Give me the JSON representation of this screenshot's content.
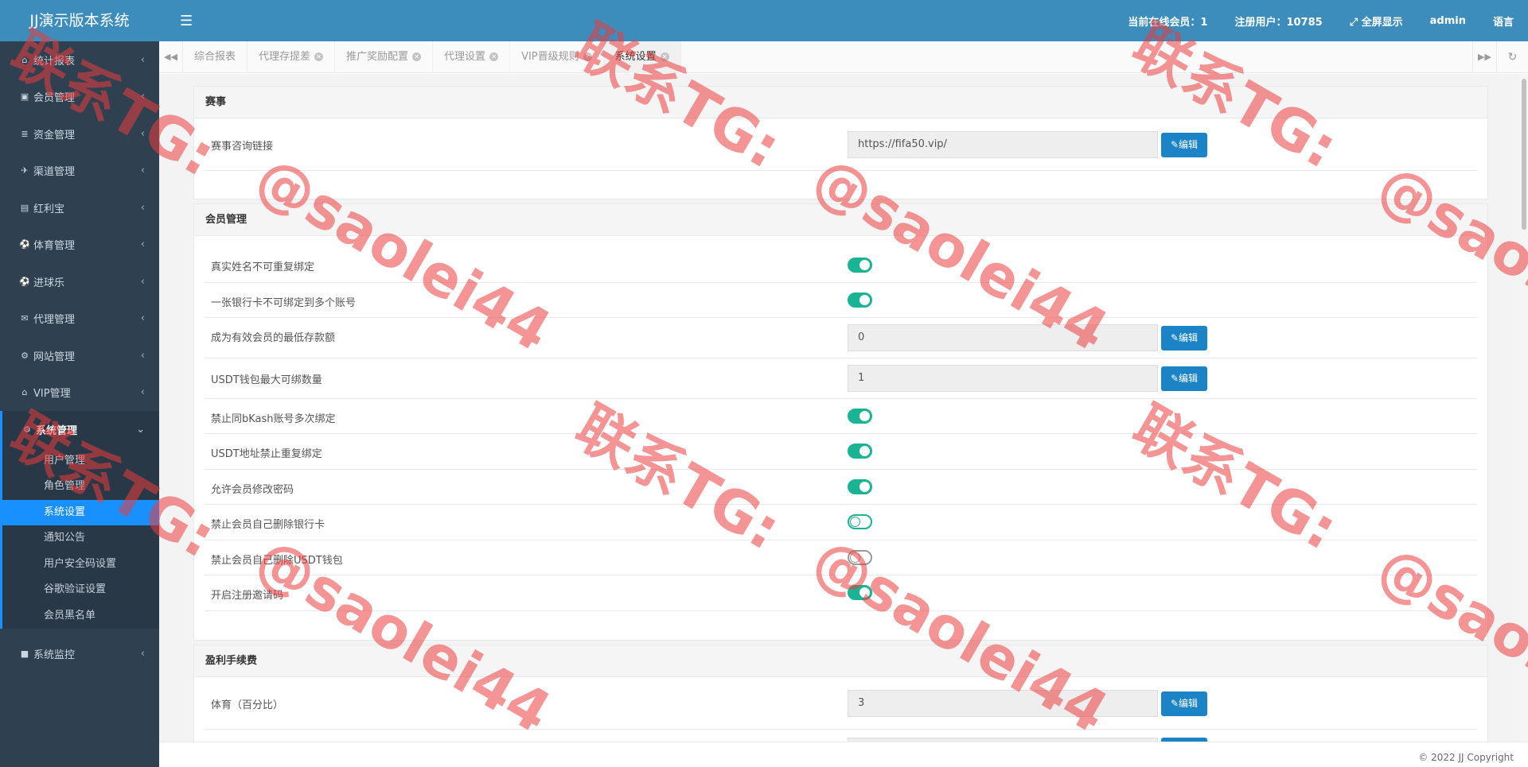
{
  "brand": "JJ演示版本系统",
  "sidebar": {
    "items": [
      {
        "label": "统计报表",
        "icon": "home-icon",
        "glyph": "⌂"
      },
      {
        "label": "会员管理",
        "icon": "user-icon",
        "glyph": "▣"
      },
      {
        "label": "资金管理",
        "icon": "database-icon",
        "glyph": "≣"
      },
      {
        "label": "渠道管理",
        "icon": "rocket-icon",
        "glyph": "✈"
      },
      {
        "label": "红利宝",
        "icon": "server-icon",
        "glyph": "▤"
      },
      {
        "label": "体育管理",
        "icon": "soccer-icon",
        "glyph": "⚽"
      },
      {
        "label": "进球乐",
        "icon": "soccer-icon",
        "glyph": "⚽"
      },
      {
        "label": "代理管理",
        "icon": "envelope-icon",
        "glyph": "✉"
      },
      {
        "label": "网站管理",
        "icon": "cogs-icon",
        "glyph": "⚙"
      },
      {
        "label": "VIP管理",
        "icon": "lock-icon",
        "glyph": "🔒"
      },
      {
        "label": "系统管理",
        "icon": "gear-icon",
        "glyph": "⚙"
      }
    ],
    "submenu": [
      "用户管理",
      "角色管理",
      "系统设置",
      "通知公告",
      "用户安全码设置",
      "谷歌验证设置",
      "会员黑名单"
    ],
    "last_item": {
      "label": "系统监控",
      "icon": "video-icon",
      "glyph": "■"
    }
  },
  "topbar": {
    "online": "当前在线会员：1",
    "registered": "注册用户：10785",
    "fullscreen": "全屏显示",
    "user": "admin",
    "language": "语言"
  },
  "tabs": [
    "综合报表",
    "代理存提差",
    "推广奖励配置",
    "代理设置",
    "VIP晋级规则",
    "系统设置"
  ],
  "sections": {
    "event": {
      "title": "赛事",
      "rows": [
        {
          "label": "赛事咨询链接",
          "value": "https://fifa50.vip/"
        }
      ]
    },
    "member": {
      "title": "会员管理",
      "rows": [
        {
          "label": "真实姓名不可重复绑定"
        },
        {
          "label": "一张银行卡不可绑定到多个账号"
        },
        {
          "label": "成为有效会员的最低存款额",
          "value": "0"
        },
        {
          "label": "USDT钱包最大可绑数量",
          "value": "1"
        },
        {
          "label": "禁止同bKash账号多次绑定"
        },
        {
          "label": "USDT地址禁止重复绑定"
        },
        {
          "label": "允许会员修改密码"
        },
        {
          "label": "禁止会员自己删除银行卡"
        },
        {
          "label": "禁止会员自己删除USDT钱包"
        },
        {
          "label": "开启注册邀请码"
        }
      ]
    },
    "fee": {
      "title": "盈利手续费",
      "rows": [
        {
          "label": "体育（百分比）",
          "value": "3"
        }
      ]
    }
  },
  "edit_label": "编辑",
  "footer": "© 2022 JJ Copyright",
  "watermark": {
    "line1": "联系TG:",
    "line2": "@saolei44"
  },
  "colors": {
    "header": "#3c8dbc",
    "sidebar": "#2f4050",
    "active": "#1890ff",
    "toggle": "#1ab394",
    "button": "#1c84c6"
  }
}
